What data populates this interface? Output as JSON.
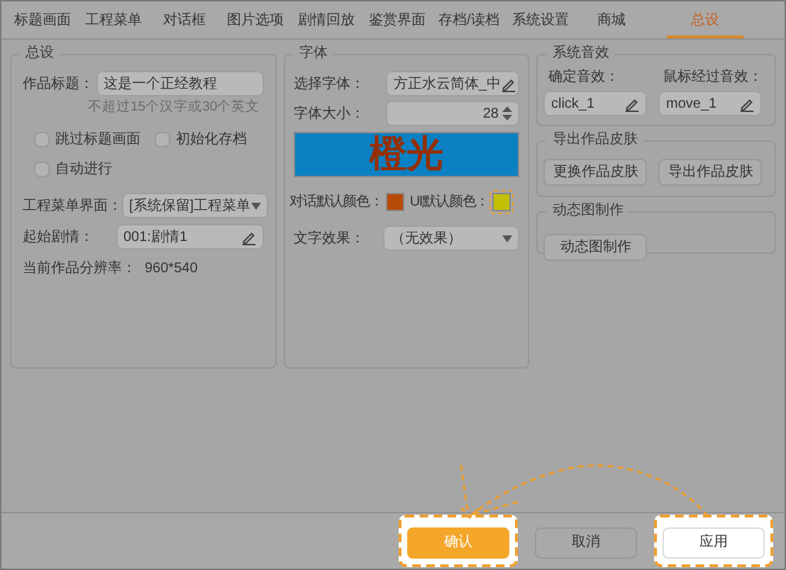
{
  "tabs": [
    {
      "label": "标题画面",
      "selected": false
    },
    {
      "label": "工程菜单",
      "selected": false
    },
    {
      "label": "对话框",
      "selected": false
    },
    {
      "label": "图片选项",
      "selected": false
    },
    {
      "label": "剧情回放",
      "selected": false
    },
    {
      "label": "鉴赏界面",
      "selected": false
    },
    {
      "label": "存档/读档",
      "selected": false
    },
    {
      "label": "系统设置",
      "selected": false
    },
    {
      "label": "商城",
      "selected": false
    },
    {
      "label": "总设",
      "selected": true
    }
  ],
  "general": {
    "title": "总设",
    "title_label": "作品标题：",
    "title_value": "这是一个正经教程",
    "title_hint": "不超过15个汉字或30个英文",
    "checkboxes": [
      {
        "label": "跳过标题画面",
        "checked": false
      },
      {
        "label": "初始化存档",
        "checked": false
      },
      {
        "label": "自动进行",
        "checked": false
      }
    ],
    "menu_label": "工程菜单界面：",
    "menu_value": "[系统保留]工程菜单",
    "start_label": "起始剧情：",
    "start_value": "001:剧情1",
    "resolution_label": "当前作品分辨率：",
    "resolution_value": "960*540"
  },
  "font": {
    "title": "字体",
    "font_label": "选择字体：",
    "font_value": "方正水云简体_中",
    "size_label": "字体大小：",
    "size_value": "28",
    "preview": "橙光",
    "swatches": [
      {
        "label": "对话默认颜色：",
        "color": "#b84a08",
        "highlighted": false
      },
      {
        "label": "UI默认颜色：",
        "color": "#c2c004",
        "highlighted": true
      }
    ],
    "effect_label": "文字效果：",
    "effect_value": "（无效果）"
  },
  "sound": {
    "title": "系统音效",
    "items": [
      {
        "label": "确定音效：",
        "value": "click_1"
      },
      {
        "label": "鼠标经过音效：",
        "value": "move_1"
      }
    ]
  },
  "skin": {
    "title": "导出作品皮肤",
    "buttons": [
      "更换作品皮肤",
      "导出作品皮肤"
    ]
  },
  "animation": {
    "title": "动态图制作",
    "button": "动态图制作"
  },
  "footer": [
    {
      "label": "确认",
      "kind": "primary",
      "highlighted": true
    },
    {
      "label": "取消",
      "kind": "default",
      "highlighted": false
    },
    {
      "label": "应用",
      "kind": "white",
      "highlighted": true
    }
  ]
}
